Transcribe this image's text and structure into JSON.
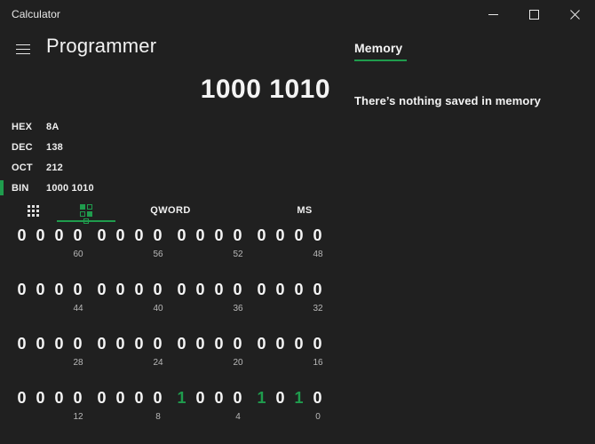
{
  "window": {
    "title": "Calculator",
    "controls": [
      {
        "name": "minimize",
        "label": "Minimize"
      },
      {
        "name": "maximize",
        "label": "Maximize"
      },
      {
        "name": "close",
        "label": "Close"
      }
    ]
  },
  "header": {
    "menu_icon": "hamburger-icon",
    "mode_title": "Programmer",
    "memory_tab": "Memory"
  },
  "display": {
    "value": "1000 1010"
  },
  "radix": {
    "rows": [
      {
        "label": "HEX",
        "value": "8A",
        "active": false
      },
      {
        "label": "DEC",
        "value": "138",
        "active": false
      },
      {
        "label": "OCT",
        "value": "212",
        "active": false
      },
      {
        "label": "BIN",
        "value": "1000 1010",
        "active": true
      }
    ]
  },
  "bit_toolbar": {
    "keypad_icon": "keypad-dots-icon",
    "bit_toggle_icon": "bit-toggle-icon",
    "word_size": "QWORD",
    "memory_store": "MS"
  },
  "bit_grid": {
    "rows": [
      {
        "nibbles": [
          {
            "bits": [
              "0",
              "0",
              "0",
              "0"
            ],
            "index": "60"
          },
          {
            "bits": [
              "0",
              "0",
              "0",
              "0"
            ],
            "index": "56"
          },
          {
            "bits": [
              "0",
              "0",
              "0",
              "0"
            ],
            "index": "52"
          },
          {
            "bits": [
              "0",
              "0",
              "0",
              "0"
            ],
            "index": "48"
          }
        ]
      },
      {
        "nibbles": [
          {
            "bits": [
              "0",
              "0",
              "0",
              "0"
            ],
            "index": "44"
          },
          {
            "bits": [
              "0",
              "0",
              "0",
              "0"
            ],
            "index": "40"
          },
          {
            "bits": [
              "0",
              "0",
              "0",
              "0"
            ],
            "index": "36"
          },
          {
            "bits": [
              "0",
              "0",
              "0",
              "0"
            ],
            "index": "32"
          }
        ]
      },
      {
        "nibbles": [
          {
            "bits": [
              "0",
              "0",
              "0",
              "0"
            ],
            "index": "28"
          },
          {
            "bits": [
              "0",
              "0",
              "0",
              "0"
            ],
            "index": "24"
          },
          {
            "bits": [
              "0",
              "0",
              "0",
              "0"
            ],
            "index": "20"
          },
          {
            "bits": [
              "0",
              "0",
              "0",
              "0"
            ],
            "index": "16"
          }
        ]
      },
      {
        "nibbles": [
          {
            "bits": [
              "0",
              "0",
              "0",
              "0"
            ],
            "index": "12"
          },
          {
            "bits": [
              "0",
              "0",
              "0",
              "0"
            ],
            "index": "8"
          },
          {
            "bits": [
              "1",
              "0",
              "0",
              "0"
            ],
            "index": "4"
          },
          {
            "bits": [
              "1",
              "0",
              "1",
              "0"
            ],
            "index": "0"
          }
        ]
      }
    ]
  },
  "memory": {
    "empty_message": "There’s nothing saved in memory"
  },
  "colors": {
    "background": "#202020",
    "accent_green": "#1f9c4d",
    "text_primary": "#f2f2f2",
    "text_secondary": "#b9b9b9"
  }
}
